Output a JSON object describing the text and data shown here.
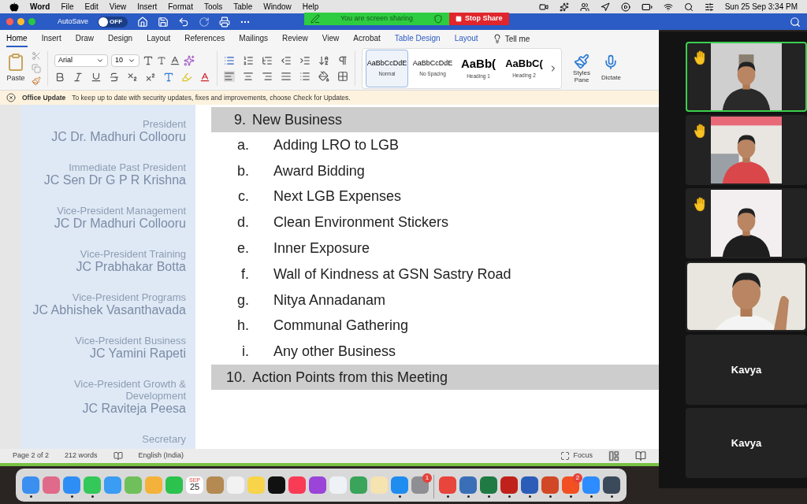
{
  "menu_bar": {
    "app": "Word",
    "menus": [
      "File",
      "Edit",
      "View",
      "Insert",
      "Format",
      "Tools",
      "Table",
      "Window",
      "Help"
    ],
    "clock": "Sun 25 Sep 3:34 PM"
  },
  "share_banner": {
    "status": "You are screen sharing",
    "stop": "Stop Share"
  },
  "title_bar": {
    "autosave_label": "AutoSave",
    "autosave": {
      "on": false,
      "label": "OFF"
    }
  },
  "ribbon": {
    "tabs": [
      {
        "label": "Home",
        "selected": true,
        "contextual": false
      },
      {
        "label": "Insert",
        "selected": false,
        "contextual": false
      },
      {
        "label": "Draw",
        "selected": false,
        "contextual": false
      },
      {
        "label": "Design",
        "selected": false,
        "contextual": false
      },
      {
        "label": "Layout",
        "selected": false,
        "contextual": false
      },
      {
        "label": "References",
        "selected": false,
        "contextual": false
      },
      {
        "label": "Mailings",
        "selected": false,
        "contextual": false
      },
      {
        "label": "Review",
        "selected": false,
        "contextual": false
      },
      {
        "label": "View",
        "selected": false,
        "contextual": false
      },
      {
        "label": "Acrobat",
        "selected": false,
        "contextual": false
      },
      {
        "label": "Table Design",
        "selected": false,
        "contextual": true
      },
      {
        "label": "Layout",
        "selected": false,
        "contextual": true
      }
    ],
    "tell_me": "Tell me",
    "paste": "Paste",
    "font": "Arial",
    "size": "10",
    "styles": [
      {
        "preview": "AaBbCcDdE",
        "name": "Normal",
        "selected": true,
        "kind": "body"
      },
      {
        "preview": "AaBbCcDdE",
        "name": "No Spacing",
        "selected": false,
        "kind": "body"
      },
      {
        "preview": "AaBb(",
        "name": "Heading 1",
        "selected": false,
        "kind": "heading"
      },
      {
        "preview": "AaBbC(",
        "name": "Heading 2",
        "selected": false,
        "kind": "heading"
      }
    ],
    "styles_pane": "Styles Pane",
    "dictate": "Dictate"
  },
  "notice": {
    "title": "Office Update",
    "message": "To keep up to date with security updates, fixes and improvements, choose Check for Updates."
  },
  "sidebar": {
    "officers": [
      {
        "role": "President",
        "name": "JC Dr. Madhuri Collooru"
      },
      {
        "role": "Immediate Past President",
        "name": "JC Sen Dr G P R Krishna"
      },
      {
        "role": "Vice-President Management",
        "name": "JC Dr Madhuri Collooru"
      },
      {
        "role": "Vice-President Training",
        "name": "JC Prabhakar Botta"
      },
      {
        "role": "Vice-President Programs",
        "name": "JC Abhishek Vasanthavada"
      },
      {
        "role": "Vice-President Business",
        "name": "JC Yamini Rapeti"
      },
      {
        "role": "Vice-President Growth & Development",
        "name": "JC Raviteja Peesa"
      },
      {
        "role": "Secretary"
      }
    ]
  },
  "document": {
    "sections": [
      {
        "number": "9.",
        "title": "New Business",
        "items": [
          {
            "marker": "a.",
            "text": "Adding LRO to LGB"
          },
          {
            "marker": "b.",
            "text": "Award Bidding"
          },
          {
            "marker": "c.",
            "text": "Next LGB Expenses"
          },
          {
            "marker": "d.",
            "text": "Clean Environment Stickers"
          },
          {
            "marker": "e.",
            "text": "Inner Exposure"
          },
          {
            "marker": "f.",
            "text": "Wall of Kindness at GSN Sastry Road"
          },
          {
            "marker": "g.",
            "text": "Nitya Annadanam"
          },
          {
            "marker": "h.",
            "text": "Communal Gathering"
          },
          {
            "marker": "i.",
            "text": "Any other Business"
          }
        ]
      },
      {
        "number": "10.",
        "title": "Action Points from this Meeting"
      }
    ]
  },
  "status_bar": {
    "page": "Page 2 of 2",
    "words": "212 words",
    "language": "English (India)",
    "focus": "Focus"
  },
  "dock": {
    "apps": [
      {
        "kind": "app",
        "color": "#3b8ff0",
        "running": true
      },
      {
        "kind": "app",
        "color": "#e06a8a",
        "running": false
      },
      {
        "kind": "app",
        "color": "#2f8ef5",
        "running": true
      },
      {
        "kind": "app",
        "color": "#34c759",
        "running": true
      },
      {
        "kind": "app",
        "color": "#3a9cf2",
        "running": false
      },
      {
        "kind": "app",
        "color": "#6fbf5a",
        "running": false
      },
      {
        "kind": "app",
        "color": "#f4b23a",
        "running": false
      },
      {
        "kind": "app",
        "color": "#2bc24d",
        "running": false
      },
      {
        "kind": "calendar",
        "month": "SEP",
        "day": "25",
        "running": false
      },
      {
        "kind": "app",
        "color": "#b48a52",
        "running": false
      },
      {
        "kind": "app",
        "color": "#f2f2f2",
        "running": false
      },
      {
        "kind": "app",
        "color": "#f7d44a",
        "running": false
      },
      {
        "kind": "app",
        "color": "#111111",
        "running": false
      },
      {
        "kind": "app",
        "color": "#fa3b55",
        "running": false
      },
      {
        "kind": "app",
        "color": "#9a45d8",
        "running": false
      },
      {
        "kind": "app",
        "color": "#eef2f7",
        "running": false
      },
      {
        "kind": "app",
        "color": "#3aa55a",
        "running": false
      },
      {
        "kind": "app",
        "color": "#f5e3b0",
        "running": false
      },
      {
        "kind": "app",
        "color": "#1f8cf0",
        "running": true
      },
      {
        "kind": "app",
        "color": "#8e8e93",
        "running": false,
        "badge": "1"
      },
      {
        "kind": "separator"
      },
      {
        "kind": "app",
        "color": "#e8453c",
        "running": true
      },
      {
        "kind": "app",
        "color": "#3a6fb8",
        "running": true
      },
      {
        "kind": "app",
        "color": "#1f7a43",
        "running": true
      },
      {
        "kind": "app",
        "color": "#c0211b",
        "running": true
      },
      {
        "kind": "app",
        "color": "#2b5cb8",
        "running": true
      },
      {
        "kind": "app",
        "color": "#d24726",
        "running": true
      },
      {
        "kind": "app",
        "color": "#f25022",
        "running": true,
        "badge": "2"
      },
      {
        "kind": "app",
        "color": "#2d8cff",
        "running": true
      },
      {
        "kind": "app",
        "color": "#3a4a5a",
        "running": true
      }
    ]
  },
  "participants": [
    {
      "kind": "video",
      "hand_raised": true,
      "active": true
    },
    {
      "kind": "video",
      "hand_raised": true,
      "active": false
    },
    {
      "kind": "video",
      "hand_raised": true,
      "active": false
    },
    {
      "kind": "video",
      "hand_raised": false,
      "active": false
    },
    {
      "kind": "name",
      "name": "Kavya",
      "hand_raised": false,
      "active": false
    },
    {
      "kind": "name",
      "name": "Kavya",
      "hand_raised": false,
      "active": false
    }
  ]
}
